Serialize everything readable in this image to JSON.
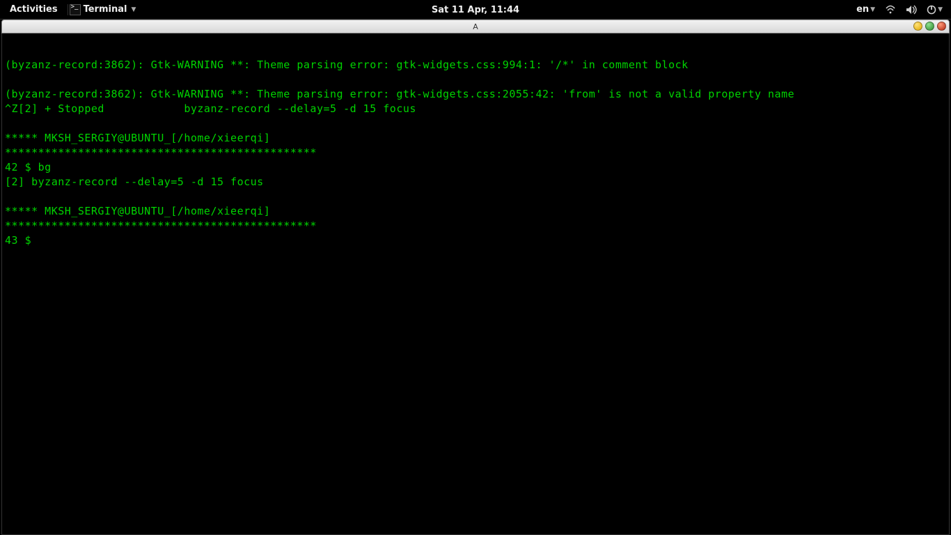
{
  "panel": {
    "activities": "Activities",
    "app_name": "Terminal",
    "clock": "Sat 11 Apr, 11:44",
    "lang": "en"
  },
  "window": {
    "title": "A"
  },
  "terminal": {
    "lines": [
      "",
      "(byzanz-record:3862): Gtk-WARNING **: Theme parsing error: gtk-widgets.css:994:1: '/*' in comment block",
      "",
      "(byzanz-record:3862): Gtk-WARNING **: Theme parsing error: gtk-widgets.css:2055:42: 'from' is not a valid property name",
      "^Z[2] + Stopped            byzanz-record --delay=5 -d 15 focus",
      "",
      "***** MKSH_SERGIY@UBUNTU_[/home/xieerqi]",
      "***********************************************",
      "42 $ bg",
      "[2] byzanz-record --delay=5 -d 15 focus",
      "",
      "***** MKSH_SERGIY@UBUNTU_[/home/xieerqi]",
      "***********************************************",
      "43 $ "
    ]
  }
}
